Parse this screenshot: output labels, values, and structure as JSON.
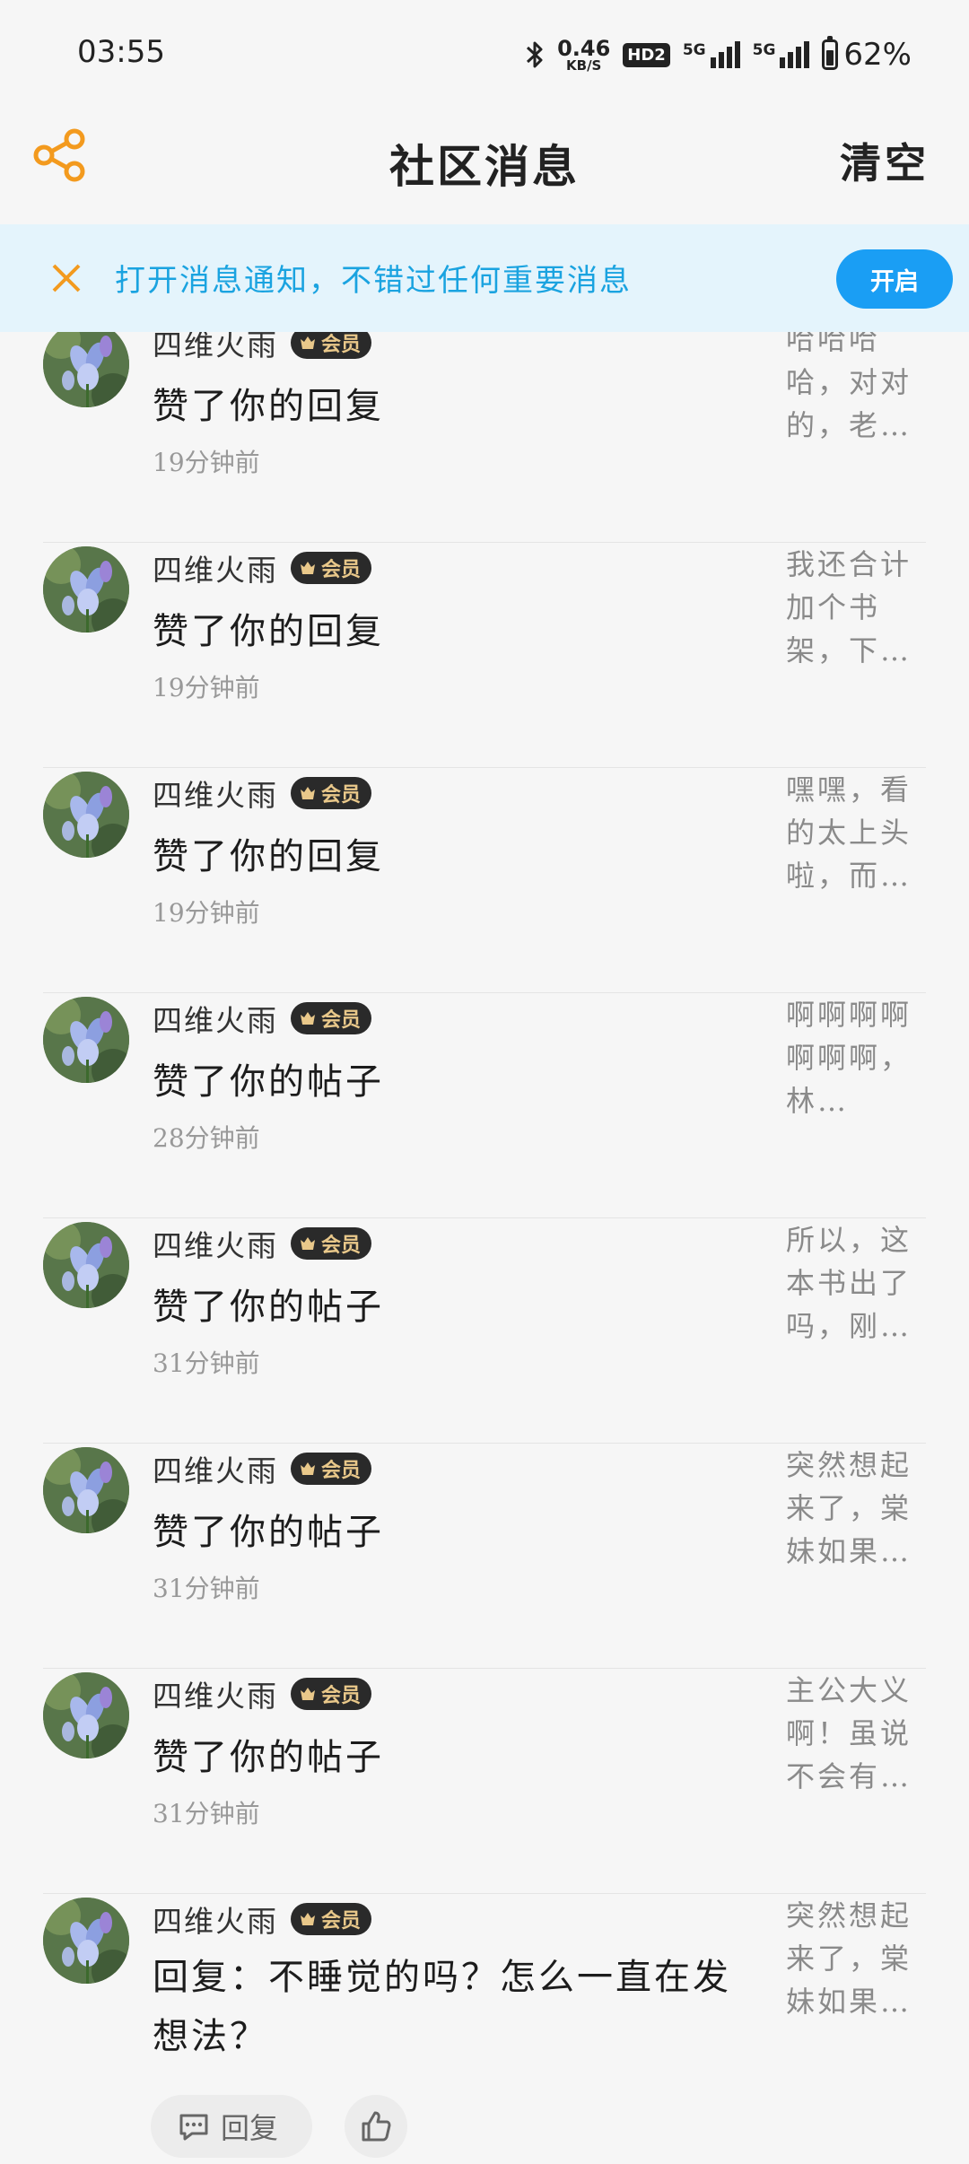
{
  "status_bar": {
    "time": "03:55",
    "net_speed": "0.46",
    "net_unit": "KB/S",
    "hd": "HD2",
    "signal_1": "5G",
    "signal_2": "5G",
    "battery": "62%",
    "battery_level": 0.62
  },
  "header": {
    "title": "社区消息",
    "clear_label": "清空"
  },
  "banner": {
    "text": "打开消息通知，不错过任何重要消息",
    "button": "开启"
  },
  "member_label": "会员",
  "messages": [
    {
      "user": "四维火雨",
      "action": "赞了你的回复",
      "time": "19分钟前",
      "preview": "哈哈哈哈，对对的，老…"
    },
    {
      "user": "四维火雨",
      "action": "赞了你的回复",
      "time": "19分钟前",
      "preview": "我还合计加个书架，下…"
    },
    {
      "user": "四维火雨",
      "action": "赞了你的回复",
      "time": "19分钟前",
      "preview": "嘿嘿，看的太上头啦，而…"
    },
    {
      "user": "四维火雨",
      "action": "赞了你的帖子",
      "time": "28分钟前",
      "preview": "啊啊啊啊啊啊啊，林…"
    },
    {
      "user": "四维火雨",
      "action": "赞了你的帖子",
      "time": "31分钟前",
      "preview": "所以，这本书出了吗，刚…"
    },
    {
      "user": "四维火雨",
      "action": "赞了你的帖子",
      "time": "31分钟前",
      "preview": "突然想起来了，棠妹如果…"
    },
    {
      "user": "四维火雨",
      "action": "赞了你的帖子",
      "time": "31分钟前",
      "preview": "主公大义啊！虽说不会有…"
    },
    {
      "user": "四维火雨",
      "action": "回复：不睡觉的吗？怎么一直在发想法？",
      "time": "",
      "preview": "突然想起来了，棠妹如果…"
    }
  ],
  "reply_label": "回复"
}
